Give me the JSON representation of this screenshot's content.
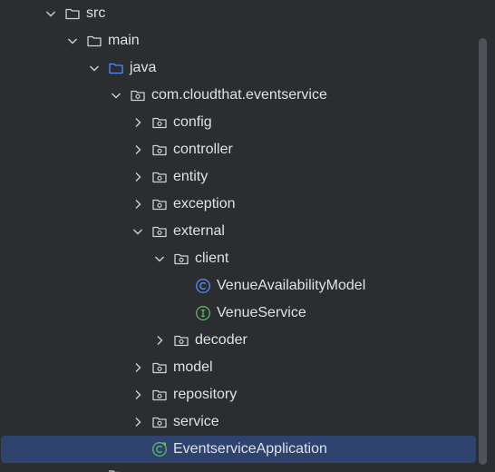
{
  "tree": {
    "rows": [
      {
        "label": "src",
        "expanded": true,
        "icon": "folder-icon"
      },
      {
        "label": "main",
        "expanded": true,
        "icon": "folder-icon"
      },
      {
        "label": "java",
        "expanded": true,
        "icon": "source-folder-icon"
      },
      {
        "label": "com.cloudthat.eventservice",
        "expanded": true,
        "icon": "package-icon"
      },
      {
        "label": "config",
        "expanded": false,
        "icon": "package-icon"
      },
      {
        "label": "controller",
        "expanded": false,
        "icon": "package-icon"
      },
      {
        "label": "entity",
        "expanded": false,
        "icon": "package-icon"
      },
      {
        "label": "exception",
        "expanded": false,
        "icon": "package-icon"
      },
      {
        "label": "external",
        "expanded": true,
        "icon": "package-icon"
      },
      {
        "label": "client",
        "expanded": true,
        "icon": "package-icon"
      },
      {
        "label": "VenueAvailabilityModel",
        "icon": "class-icon"
      },
      {
        "label": "VenueService",
        "icon": "interface-icon"
      },
      {
        "label": "decoder",
        "expanded": false,
        "icon": "package-icon"
      },
      {
        "label": "model",
        "expanded": false,
        "icon": "package-icon"
      },
      {
        "label": "repository",
        "expanded": false,
        "icon": "package-icon"
      },
      {
        "label": "service",
        "expanded": false,
        "icon": "package-icon"
      },
      {
        "label": "EventserviceApplication",
        "icon": "spring-boot-app-icon",
        "selected": true
      }
    ]
  },
  "colors": {
    "background": "#2b2d30",
    "selection": "#2e436e",
    "text": "#dfe1e5",
    "folder_stroke": "#ced0d6",
    "source_folder_stroke": "#548af7",
    "class_icon": "#548af7",
    "interface_icon": "#5fb865",
    "spring_icon": "#5fb865"
  }
}
